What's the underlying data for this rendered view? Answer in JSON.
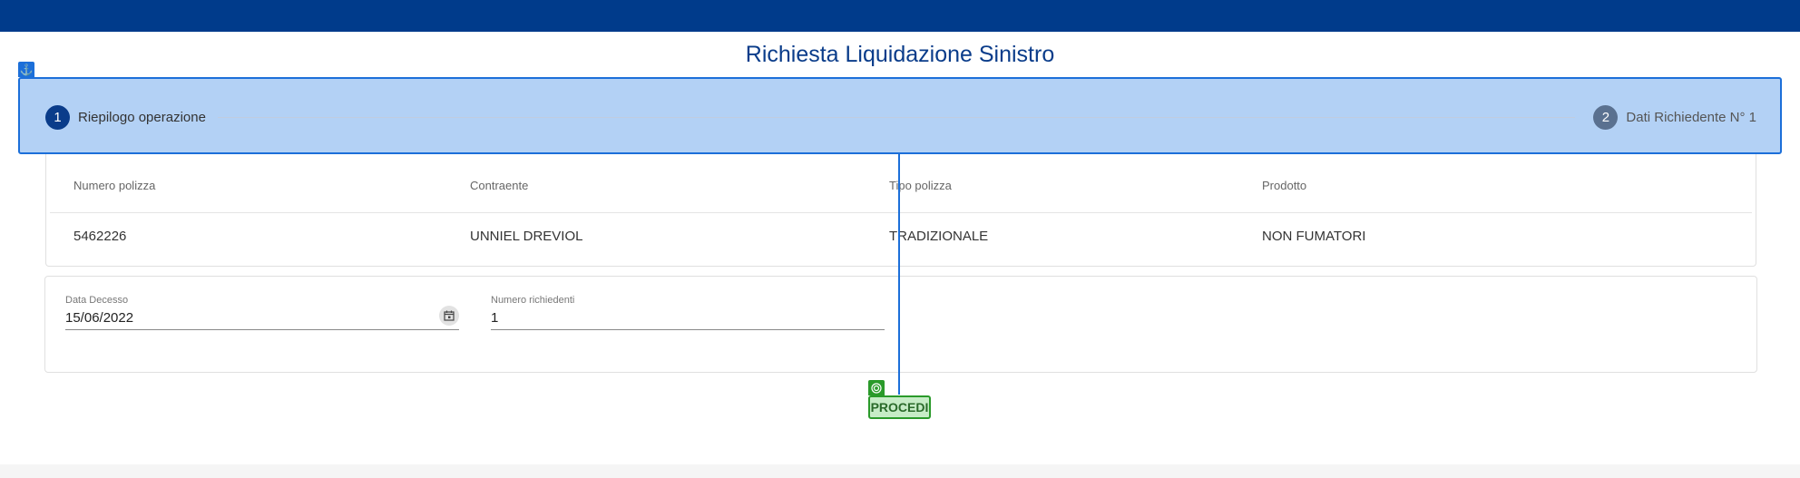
{
  "header": {
    "title": "Richiesta Liquidazione Sinistro"
  },
  "stepper": {
    "steps": [
      {
        "number": "1",
        "label": "Riepilogo operazione"
      },
      {
        "number": "2",
        "label": "Dati Richiedente N° 1"
      }
    ]
  },
  "policy_table": {
    "columns": [
      "Numero polizza",
      "Contraente",
      "Tipo polizza",
      "Prodotto"
    ],
    "row": [
      "5462226",
      "UNNIEL DREVIOL",
      "TRADIZIONALE",
      "NON FUMATORI"
    ]
  },
  "form": {
    "death_date": {
      "label": "Data Decesso",
      "value": "15/06/2022"
    },
    "requesters": {
      "label": "Numero richiedenti",
      "value": "1"
    }
  },
  "actions": {
    "proceed_label": "PROCEDI"
  },
  "colors": {
    "brand": "#003b8b",
    "highlight": "#1c6fd9",
    "target": "#2a9a2a"
  },
  "icons": {
    "anchor": "anchor-icon",
    "calendar": "calendar-icon",
    "target": "target-icon"
  }
}
